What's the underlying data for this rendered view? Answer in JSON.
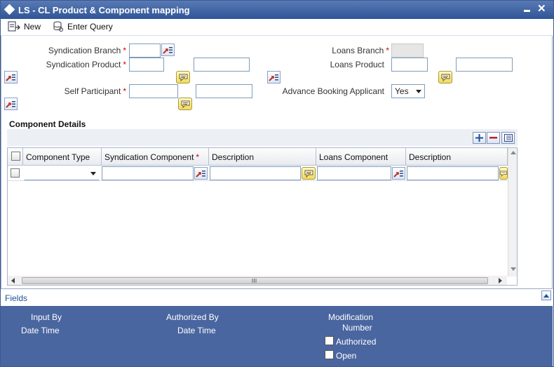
{
  "window": {
    "title": "LS - CL Product & Component mapping"
  },
  "toolbar": {
    "new_label": "New",
    "enter_query_label": "Enter Query"
  },
  "form": {
    "syndication_branch": {
      "label": "Syndication Branch",
      "value": ""
    },
    "syndication_product": {
      "label": "Syndication Product",
      "value": "",
      "desc": ""
    },
    "self_participant": {
      "label": "Self Participant",
      "value": "",
      "desc": ""
    },
    "loans_branch": {
      "label": "Loans Branch",
      "value": ""
    },
    "loans_product": {
      "label": "Loans Product",
      "value": "",
      "desc": ""
    },
    "advance_booking_applicant": {
      "label": "Advance Booking Applicant",
      "value": "Yes"
    },
    "required_mark": "*"
  },
  "component_details": {
    "title": "Component Details",
    "columns": [
      "Component Type",
      "Syndication Component",
      "Description",
      "Loans Component",
      "Description"
    ],
    "rows": [
      {
        "component_type": "",
        "syndication_component": "",
        "description": "",
        "loans_component": "",
        "loans_description": ""
      }
    ]
  },
  "fields_bar": {
    "label": "Fields"
  },
  "footer": {
    "input_by": "Input By",
    "date_time_1": "Date Time",
    "authorized_by": "Authorized By",
    "date_time_2": "Date Time",
    "modification": "Modification",
    "number": "Number",
    "authorized": "Authorized",
    "open": "Open"
  },
  "colors": {
    "title_bar": "#2f5597",
    "footer": "#4a66a0",
    "required": "#cc0000"
  }
}
